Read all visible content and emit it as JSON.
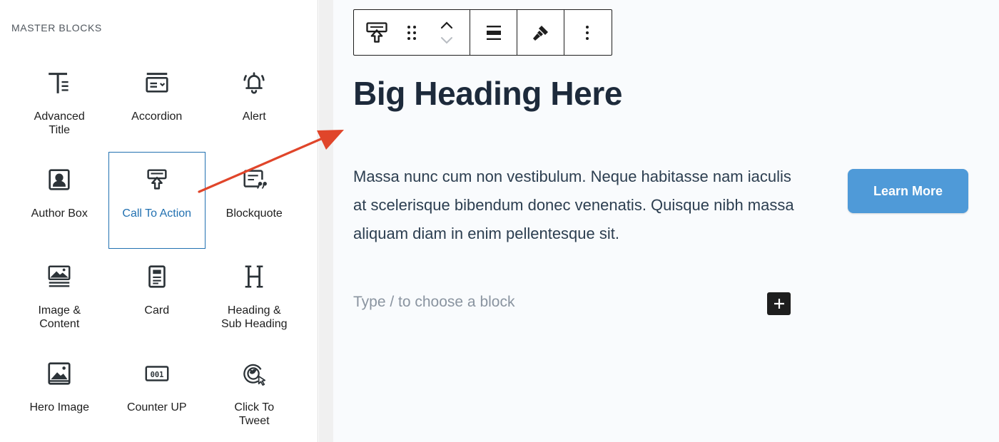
{
  "sidebar": {
    "title": "MASTER BLOCKS",
    "blocks": [
      {
        "label": "Advanced\nTitle",
        "icon": "advanced-title-icon"
      },
      {
        "label": "Accordion",
        "icon": "accordion-icon"
      },
      {
        "label": "Alert",
        "icon": "bell-icon"
      },
      {
        "label": "Author Box",
        "icon": "author-box-icon"
      },
      {
        "label": "Call To Action",
        "icon": "call-to-action-icon",
        "selected": true
      },
      {
        "label": "Blockquote",
        "icon": "blockquote-icon"
      },
      {
        "label": "Image &\nContent",
        "icon": "image-content-icon"
      },
      {
        "label": "Card",
        "icon": "card-icon"
      },
      {
        "label": "Heading &\nSub Heading",
        "icon": "heading-icon"
      },
      {
        "label": "Hero Image",
        "icon": "hero-image-icon"
      },
      {
        "label": "Counter UP",
        "icon": "counter-icon"
      },
      {
        "label": "Click To\nTweet",
        "icon": "tweet-icon"
      }
    ]
  },
  "toolbar": {
    "buttons": [
      "call-to-action-icon",
      "drag-handle-icon",
      "move-up-icon",
      "move-down-icon",
      "align-icon",
      "brush-icon",
      "more-options-icon"
    ]
  },
  "editor": {
    "heading": "Big Heading Here",
    "body": "Massa nunc cum non vestibulum. Neque habitasse nam iaculis at scelerisque bibendum donec venenatis. Quisque nibh massa aliquam diam in enim pellentesque sit.",
    "button_label": "Learn More",
    "placeholder": "Type / to choose a block"
  },
  "colors": {
    "selected": "#2271b1",
    "cta_button": "#4f9ad8",
    "annotation_arrow": "#e0452a",
    "heading": "#1d2a3b"
  }
}
